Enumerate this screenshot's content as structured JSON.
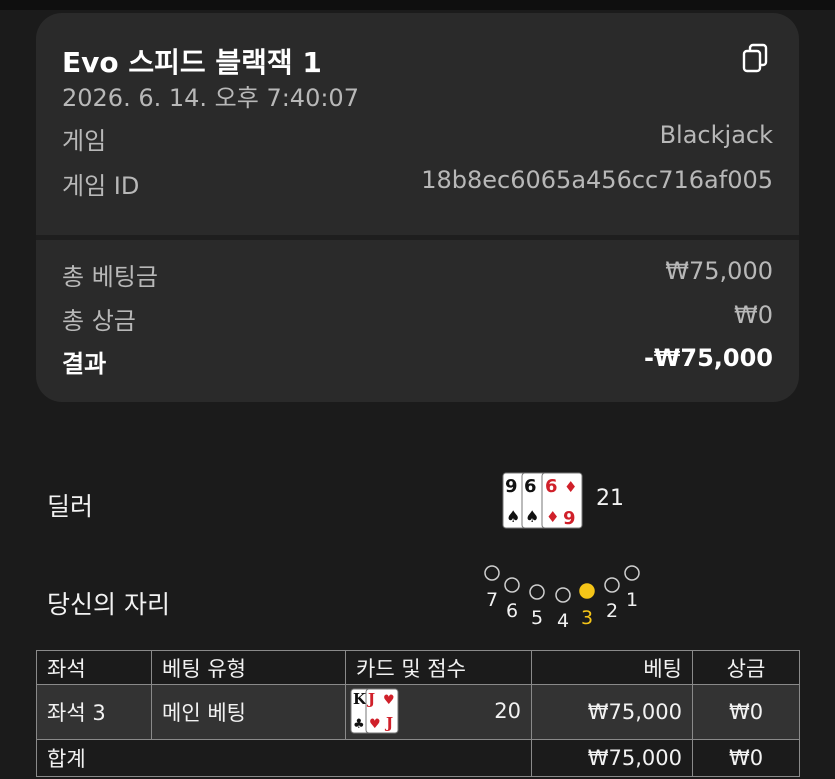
{
  "header": {
    "title": "Evo 스피드 블랙잭 1",
    "datetime": "2026. 6. 14. 오후 7:40:07",
    "game_label": "게임",
    "game_value": "Blackjack",
    "game_id_label": "게임 ID",
    "game_id_value": "18b8ec6065a456cc716af005",
    "copy_icon": "copy-icon"
  },
  "summary": {
    "total_bet_label": "총 베팅금",
    "total_bet_value": "₩75,000",
    "total_win_label": "총 상금",
    "total_win_value": "₩0",
    "result_label": "결과",
    "result_value": "-₩75,000"
  },
  "dealer": {
    "label": "딜러",
    "cards": [
      "9♠",
      "6♠",
      "6♦",
      "9♦"
    ],
    "score": "21"
  },
  "seat_map": {
    "label": "당신의 자리",
    "seats": [
      "7",
      "6",
      "5",
      "4",
      "3",
      "2",
      "1"
    ],
    "active_seat": "3",
    "active_color": "#f5c518"
  },
  "table": {
    "headers": [
      "좌석",
      "베팅 유형",
      "카드 및 점수",
      "베팅",
      "상금"
    ],
    "rows": [
      {
        "seat": "좌석 3",
        "bet_type": "메인 베팅",
        "cards": [
          "K♣",
          "J♥"
        ],
        "score": "20",
        "bet": "₩75,000",
        "win": "₩0"
      }
    ],
    "total": {
      "label": "합계",
      "bet": "₩75,000",
      "win": "₩0"
    }
  }
}
